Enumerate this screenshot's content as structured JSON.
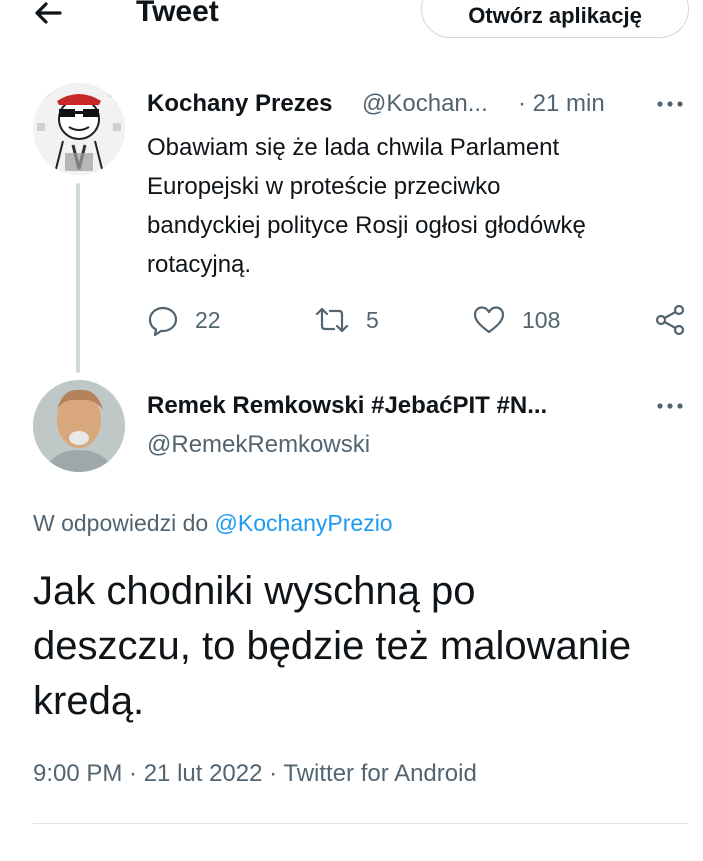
{
  "header": {
    "back_icon": "arrow-left-icon",
    "title": "Tweet",
    "open_app_label": "Otwórz aplikację"
  },
  "tweet": {
    "author_name": "Kochany Prezes",
    "author_handle": "@Kochan...",
    "time": "· 21 min",
    "text_lines": [
      "Obawiam się że lada chwila Parlament",
      "Europejski w proteście przeciwko",
      "bandyckiej polityce Rosji ogłosi głodówkę",
      "rotacyjną."
    ],
    "replies": "22",
    "retweets": "5",
    "likes": "108"
  },
  "reply": {
    "author_name": "Remek Remkowski #JebaćPIT #N...",
    "author_handle": "@RemekRemkowski",
    "reply_prefix": "W odpowiedzi do",
    "reply_mention": "@KochanyPrezio",
    "text_lines": [
      "Jak chodniki wyschną po",
      "deszczu, to będzie też malowanie",
      "kredą."
    ],
    "meta": "9:00 PM · 21 lut 2022 · Twitter for Android"
  },
  "colors": {
    "text": "#0f1419",
    "secondary": "#536471",
    "accent": "#1d9bf0",
    "border": "#cfd9de"
  }
}
